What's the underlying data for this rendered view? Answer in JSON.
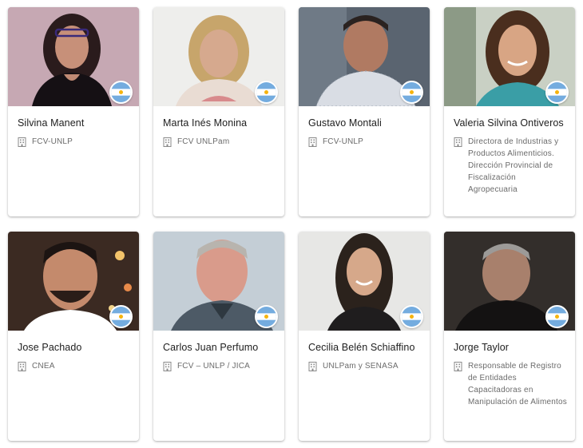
{
  "colors": {
    "card_background": "#ffffff",
    "name_text": "#202020",
    "org_text": "#6b6b6b",
    "flag_blue": "#74acdf",
    "flag_sun": "#f6b40e"
  },
  "icons": {
    "org": "building-icon",
    "flag": "argentina-flag-icon"
  },
  "speakers": [
    {
      "name": "Silvina Manent",
      "org": "FCV-UNLP"
    },
    {
      "name": "Marta Inés Monina",
      "org": "FCV UNLPam"
    },
    {
      "name": "Gustavo Montali",
      "org": "FCV-UNLP"
    },
    {
      "name": "Valeria Silvina Ontiveros",
      "org": "Directora de Industrias y Productos Alimenticios. Dirección Provincial de Fiscalización Agropecuaria"
    },
    {
      "name": "Jose Pachado",
      "org": "CNEA"
    },
    {
      "name": "Carlos Juan Perfumo",
      "org": "FCV – UNLP / JICA"
    },
    {
      "name": "Cecilia Belén Schiaffino",
      "org": "UNLPam y SENASA"
    },
    {
      "name": "Jorge Taylor",
      "org": "Responsable de Registro de Entidades Capacitadoras en Manipulación de Alimentos"
    }
  ]
}
